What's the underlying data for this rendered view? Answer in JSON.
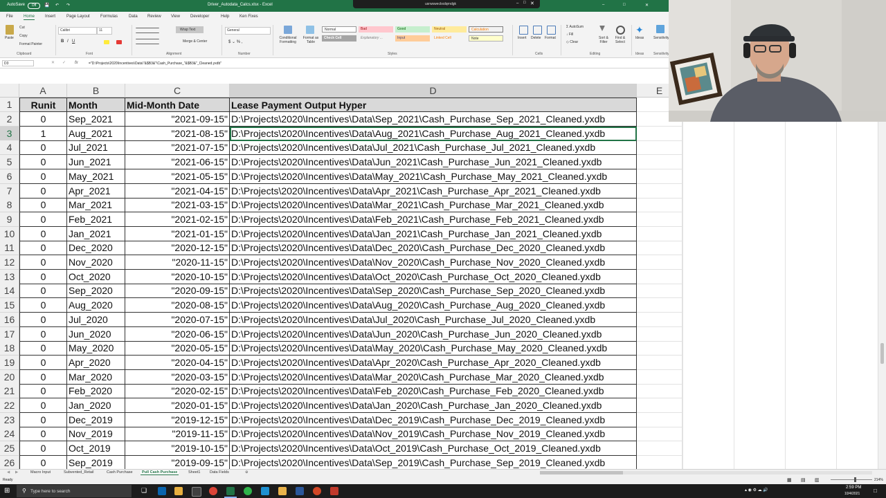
{
  "window": {
    "autosave_label": "AutoSave",
    "autosave_state": "Off",
    "title": "Driver_Autodata_Calcs.xlsx  -  Excel",
    "remote_session_title": "usrwsweckxdqrndgk"
  },
  "ribbon_tabs": [
    "File",
    "Home",
    "Insert",
    "Page Layout",
    "Formulas",
    "Data",
    "Review",
    "View",
    "Developer",
    "Help",
    "Ken Fixes"
  ],
  "ribbon": {
    "clipboard": {
      "paste": "Paste",
      "cut": "Cut",
      "copy": "Copy",
      "format_painter": "Format Painter",
      "group": "Clipboard"
    },
    "font": {
      "name": "Calibri",
      "size": "11",
      "group": "Font"
    },
    "alignment": {
      "wrap_text": "Wrap Text",
      "merge_center": "Merge & Center",
      "group": "Alignment"
    },
    "number": {
      "format": "General",
      "group": "Number"
    },
    "styles": {
      "conditional_formatting": "Conditional Formatting",
      "format_as_table": "Format as Table",
      "cells_row1": [
        "Normal",
        "Bad",
        "Good",
        "Neutral",
        "Calculation"
      ],
      "cells_row2": [
        "Check Cell",
        "Explanatory ...",
        "Input",
        "Linked Cell",
        "Note"
      ],
      "group": "Styles"
    },
    "cells": {
      "insert": "Insert",
      "delete": "Delete",
      "format": "Format",
      "group": "Cells"
    },
    "editing": {
      "autosum": "AutoSum",
      "fill": "Fill",
      "clear": "Clear",
      "sort_filter": "Sort & Filter",
      "find_select": "Find & Select",
      "group": "Editing"
    },
    "ideas": {
      "label": "Ideas",
      "group": "Ideas"
    },
    "sensitivity": {
      "label": "Sensitivity",
      "group": "Sensitivity"
    }
  },
  "formula_bar": {
    "name_box": "D3",
    "formula": "=\"D:\\Projects\\2020\\Incentives\\Data\\\"&$B3&\"\\Cash_Purchase_\"&$B3&\"_Cleaned.yxdb\""
  },
  "columns": [
    "A",
    "B",
    "C",
    "D",
    "E"
  ],
  "headers": [
    "Runit",
    "Month",
    "Mid-Month Date",
    "Lease Payment Output Hyper"
  ],
  "rows": [
    {
      "n": "2",
      "a": "0",
      "b": "Sep_2021",
      "c": "\"2021-09-15\"",
      "d": "D:\\Projects\\2020\\Incentives\\Data\\Sep_2021\\Cash_Purchase_Sep_2021_Cleaned.yxdb"
    },
    {
      "n": "3",
      "a": "1",
      "b": "Aug_2021",
      "c": "\"2021-08-15\"",
      "d": "D:\\Projects\\2020\\Incentives\\Data\\Aug_2021\\Cash_Purchase_Aug_2021_Cleaned.yxdb"
    },
    {
      "n": "4",
      "a": "0",
      "b": "Jul_2021",
      "c": "\"2021-07-15\"",
      "d": "D:\\Projects\\2020\\Incentives\\Data\\Jul_2021\\Cash_Purchase_Jul_2021_Cleaned.yxdb"
    },
    {
      "n": "5",
      "a": "0",
      "b": "Jun_2021",
      "c": "\"2021-06-15\"",
      "d": "D:\\Projects\\2020\\Incentives\\Data\\Jun_2021\\Cash_Purchase_Jun_2021_Cleaned.yxdb"
    },
    {
      "n": "6",
      "a": "0",
      "b": "May_2021",
      "c": "\"2021-05-15\"",
      "d": "D:\\Projects\\2020\\Incentives\\Data\\May_2021\\Cash_Purchase_May_2021_Cleaned.yxdb"
    },
    {
      "n": "7",
      "a": "0",
      "b": "Apr_2021",
      "c": "\"2021-04-15\"",
      "d": "D:\\Projects\\2020\\Incentives\\Data\\Apr_2021\\Cash_Purchase_Apr_2021_Cleaned.yxdb"
    },
    {
      "n": "8",
      "a": "0",
      "b": "Mar_2021",
      "c": "\"2021-03-15\"",
      "d": "D:\\Projects\\2020\\Incentives\\Data\\Mar_2021\\Cash_Purchase_Mar_2021_Cleaned.yxdb"
    },
    {
      "n": "9",
      "a": "0",
      "b": "Feb_2021",
      "c": "\"2021-02-15\"",
      "d": "D:\\Projects\\2020\\Incentives\\Data\\Feb_2021\\Cash_Purchase_Feb_2021_Cleaned.yxdb"
    },
    {
      "n": "10",
      "a": "0",
      "b": "Jan_2021",
      "c": "\"2021-01-15\"",
      "d": "D:\\Projects\\2020\\Incentives\\Data\\Jan_2021\\Cash_Purchase_Jan_2021_Cleaned.yxdb"
    },
    {
      "n": "11",
      "a": "0",
      "b": "Dec_2020",
      "c": "\"2020-12-15\"",
      "d": "D:\\Projects\\2020\\Incentives\\Data\\Dec_2020\\Cash_Purchase_Dec_2020_Cleaned.yxdb"
    },
    {
      "n": "12",
      "a": "0",
      "b": "Nov_2020",
      "c": "\"2020-11-15\"",
      "d": "D:\\Projects\\2020\\Incentives\\Data\\Nov_2020\\Cash_Purchase_Nov_2020_Cleaned.yxdb"
    },
    {
      "n": "13",
      "a": "0",
      "b": "Oct_2020",
      "c": "\"2020-10-15\"",
      "d": "D:\\Projects\\2020\\Incentives\\Data\\Oct_2020\\Cash_Purchase_Oct_2020_Cleaned.yxdb"
    },
    {
      "n": "14",
      "a": "0",
      "b": "Sep_2020",
      "c": "\"2020-09-15\"",
      "d": "D:\\Projects\\2020\\Incentives\\Data\\Sep_2020\\Cash_Purchase_Sep_2020_Cleaned.yxdb"
    },
    {
      "n": "15",
      "a": "0",
      "b": "Aug_2020",
      "c": "\"2020-08-15\"",
      "d": "D:\\Projects\\2020\\Incentives\\Data\\Aug_2020\\Cash_Purchase_Aug_2020_Cleaned.yxdb"
    },
    {
      "n": "16",
      "a": "0",
      "b": "Jul_2020",
      "c": "\"2020-07-15\"",
      "d": "D:\\Projects\\2020\\Incentives\\Data\\Jul_2020\\Cash_Purchase_Jul_2020_Cleaned.yxdb"
    },
    {
      "n": "17",
      "a": "0",
      "b": "Jun_2020",
      "c": "\"2020-06-15\"",
      "d": "D:\\Projects\\2020\\Incentives\\Data\\Jun_2020\\Cash_Purchase_Jun_2020_Cleaned.yxdb"
    },
    {
      "n": "18",
      "a": "0",
      "b": "May_2020",
      "c": "\"2020-05-15\"",
      "d": "D:\\Projects\\2020\\Incentives\\Data\\May_2020\\Cash_Purchase_May_2020_Cleaned.yxdb"
    },
    {
      "n": "19",
      "a": "0",
      "b": "Apr_2020",
      "c": "\"2020-04-15\"",
      "d": "D:\\Projects\\2020\\Incentives\\Data\\Apr_2020\\Cash_Purchase_Apr_2020_Cleaned.yxdb"
    },
    {
      "n": "20",
      "a": "0",
      "b": "Mar_2020",
      "c": "\"2020-03-15\"",
      "d": "D:\\Projects\\2020\\Incentives\\Data\\Mar_2020\\Cash_Purchase_Mar_2020_Cleaned.yxdb"
    },
    {
      "n": "21",
      "a": "0",
      "b": "Feb_2020",
      "c": "\"2020-02-15\"",
      "d": "D:\\Projects\\2020\\Incentives\\Data\\Feb_2020\\Cash_Purchase_Feb_2020_Cleaned.yxdb"
    },
    {
      "n": "22",
      "a": "0",
      "b": "Jan_2020",
      "c": "\"2020-01-15\"",
      "d": "D:\\Projects\\2020\\Incentives\\Data\\Jan_2020\\Cash_Purchase_Jan_2020_Cleaned.yxdb"
    },
    {
      "n": "23",
      "a": "0",
      "b": "Dec_2019",
      "c": "\"2019-12-15\"",
      "d": "D:\\Projects\\2020\\Incentives\\Data\\Dec_2019\\Cash_Purchase_Dec_2019_Cleaned.yxdb"
    },
    {
      "n": "24",
      "a": "0",
      "b": "Nov_2019",
      "c": "\"2019-11-15\"",
      "d": "D:\\Projects\\2020\\Incentives\\Data\\Nov_2019\\Cash_Purchase_Nov_2019_Cleaned.yxdb"
    },
    {
      "n": "25",
      "a": "0",
      "b": "Oct_2019",
      "c": "\"2019-10-15\"",
      "d": "D:\\Projects\\2020\\Incentives\\Data\\Oct_2019\\Cash_Purchase_Oct_2019_Cleaned.yxdb"
    },
    {
      "n": "26",
      "a": "0",
      "b": "Sep_2019",
      "c": "\"2019-09-15\"",
      "d": "D:\\Projects\\2020\\Incentives\\Data\\Sep_2019\\Cash_Purchase_Sep_2019_Cleaned.yxdb"
    }
  ],
  "sheet_tabs": [
    "Macro Input",
    "Subvented_Retail",
    "Cash Purchase",
    "Pull Cash Purchase",
    "Sheet1",
    "Data Fields"
  ],
  "active_sheet": "Pull Cash Purchase",
  "status": {
    "ready": "Ready",
    "zoom": "214%"
  },
  "taskbar": {
    "search_placeholder": "Type here to search",
    "time": "2:59 PM",
    "date": "10/4/2021"
  },
  "colors": {
    "excel_green": "#217346",
    "header_fill": "#d9d9d9",
    "bad": "#ffc7ce",
    "good": "#c6efce",
    "neutral": "#ffeb9c"
  },
  "icons": [
    "excel-icon",
    "search-icon",
    "windows-start-icon",
    "chrome-icon",
    "word-icon",
    "outlook-icon",
    "powerpoint-icon",
    "file-explorer-icon"
  ]
}
